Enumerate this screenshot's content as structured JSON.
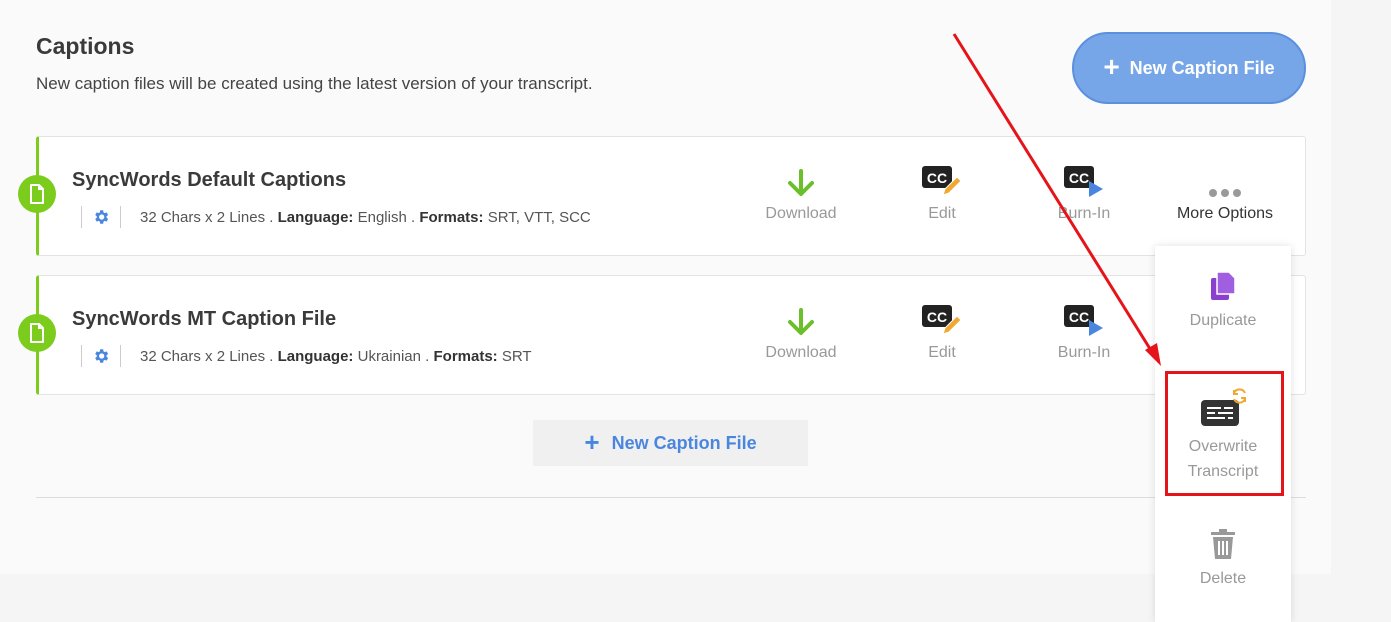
{
  "header": {
    "title": "Captions",
    "subtitle": "New caption files will be created using the latest version of your transcript.",
    "new_button_label": "New Caption File"
  },
  "captions": [
    {
      "title": "SyncWords Default Captions",
      "chars": "32 Chars x 2 Lines",
      "language_label": "Language:",
      "language": "English",
      "formats_label": "Formats:",
      "formats": "SRT, VTT, SCC"
    },
    {
      "title": "SyncWords MT Caption File",
      "chars": "32 Chars x 2 Lines",
      "language_label": "Language:",
      "language": "Ukrainian",
      "formats_label": "Formats:",
      "formats": "SRT"
    }
  ],
  "actions": {
    "download": "Download",
    "edit": "Edit",
    "burn_in": "Burn-In",
    "more_options": "More Options"
  },
  "footer": {
    "new_button_label": "New Caption File"
  },
  "more_menu": {
    "duplicate": "Duplicate",
    "overwrite_line1": "Overwrite",
    "overwrite_line2": "Transcript",
    "delete": "Delete"
  },
  "colors": {
    "accent_blue": "#4a86e0",
    "status_green": "#7ccc1e",
    "highlight_red": "#e5141a",
    "duplicate_purple": "#8b3fcf"
  }
}
